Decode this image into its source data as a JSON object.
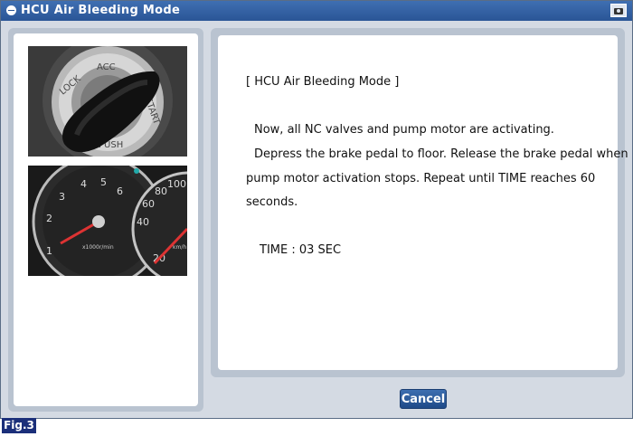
{
  "window": {
    "title": "HCU Air Bleeding Mode"
  },
  "icons": {
    "title_icon": "circle-icon",
    "screenshot": "camera-icon"
  },
  "ignition_image": {
    "labels": [
      "LOCK",
      "ACC",
      "START",
      "PUSH"
    ]
  },
  "cluster_image": {
    "tach_labels": [
      "1",
      "2",
      "3",
      "4",
      "5",
      "6"
    ],
    "tach_unit": "x1000r/min",
    "speed_labels": [
      "20",
      "40",
      "60",
      "80",
      "100"
    ],
    "speed_unit": "km/h"
  },
  "message": {
    "heading": "[ HCU Air Bleeding Mode ]",
    "line1": "Now, all NC valves and pump motor are activating.",
    "line2": "Depress the brake pedal to floor. Release the brake pedal when",
    "line3": "pump motor activation stops. Repeat until TIME reaches 60",
    "line4": "seconds.",
    "time": "TIME : 03 SEC"
  },
  "buttons": {
    "cancel": "Cancel"
  },
  "figure_label": "Fig.3",
  "colors": {
    "title_bar": "#2f5c9e",
    "panel": "#b9c3d0",
    "cancel_button": "#2a5596",
    "fig_label": "#1b2f7a"
  }
}
